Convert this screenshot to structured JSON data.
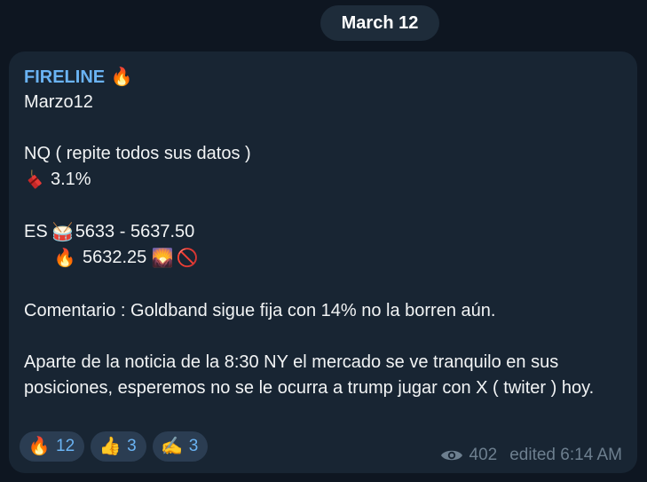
{
  "date_separator": "March 12",
  "message": {
    "channel_name": "FIRELINE",
    "channel_emoji": "🔥",
    "lines": {
      "l1": "Marzo12",
      "l2": "NQ ( repite todos sus datos )",
      "l3_value": "3.1%",
      "l4_prefix": "ES",
      "l4_value": "5633 - 5637.50",
      "l5_value": "5632.25",
      "comment": "Comentario : Goldband sigue fija con 14% no la borren aún.",
      "note": "Aparte de la noticia de la 8:30 NY el mercado se ve tranquilo en sus posiciones, esperemos no se le ocurra a trump jugar con X ( twiter ) hoy."
    },
    "emojis": {
      "drum": "🥁",
      "fire": "🔥",
      "sunrise": "🌄",
      "no_entry": "🚫"
    },
    "icons": {
      "dynamite": "dynamite-icon",
      "eye": "eye-icon"
    }
  },
  "reactions": [
    {
      "emoji": "🔥",
      "count": "12"
    },
    {
      "emoji": "👍",
      "count": "3"
    },
    {
      "emoji": "✍️",
      "count": "3"
    }
  ],
  "meta": {
    "views": "402",
    "edited": "edited 6:14 AM"
  },
  "colors": {
    "background": "#0e1621",
    "bubble": "#182533",
    "accent": "#6ab3f3",
    "meta_text": "#6d7f8f",
    "reaction_bg": "#2b3d52"
  }
}
